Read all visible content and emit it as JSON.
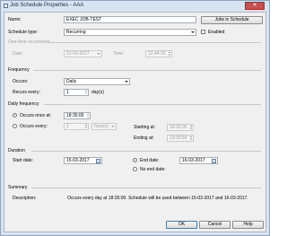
{
  "window": {
    "title": "Job Schedule Properties - AAA",
    "close_glyph": "✕"
  },
  "name": {
    "label": "Name:",
    "value": "EXEC JOB-TEST",
    "jobs_button": "Jobs in Schedule"
  },
  "schedule_type": {
    "label": "Schedule type:",
    "value": "Recurring",
    "enabled_label": "Enabled"
  },
  "one_time": {
    "header": "One-time occurrence",
    "date_label": "Date:",
    "date_value": "21-03-2017",
    "time_label": "Time:",
    "time_value": "12:44:15"
  },
  "frequency": {
    "header": "Frequency",
    "occurs_label": "Occurs:",
    "occurs_value": "Daily",
    "recurs_label": "Recurs every:",
    "recurs_value": "1",
    "recurs_unit": "day(s)"
  },
  "daily_frequency": {
    "header": "Daily frequency",
    "once_label": "Occurs once at:",
    "once_value": "18:35:00",
    "every_label": "Occurs every:",
    "every_value": "1",
    "every_unit": "hour(s)",
    "starting_label": "Starting at:",
    "starting_value": "18:35:00",
    "ending_label": "Ending at:",
    "ending_value": "23:59:59"
  },
  "duration": {
    "header": "Duration",
    "start_label": "Start date:",
    "start_value": "15-03-2017",
    "end_label": "End date:",
    "end_value": "16-03-2017",
    "no_end_label": "No end date:"
  },
  "summary": {
    "header": "Summary",
    "desc_label": "Description:",
    "desc_text": "Occurs every day at 18:35:00. Schedule will be used between 15-03-2017 and 16-03-2017."
  },
  "buttons": {
    "ok": "OK",
    "cancel": "Cancel",
    "help": "Help"
  }
}
